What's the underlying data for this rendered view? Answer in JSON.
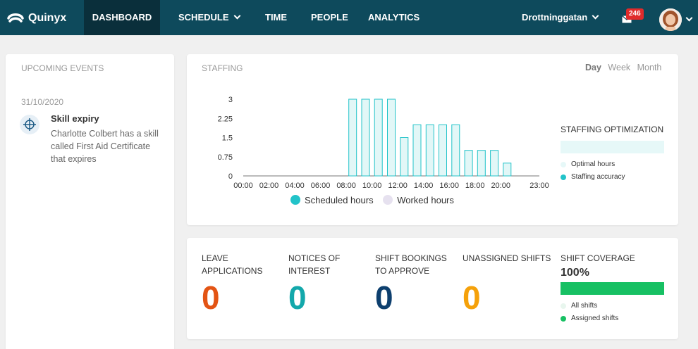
{
  "nav": {
    "logo": "Quinyx",
    "items": [
      "DASHBOARD",
      "SCHEDULE",
      "TIME",
      "PEOPLE",
      "ANALYTICS"
    ],
    "location": "Drottninggatan",
    "notifications": "246"
  },
  "events": {
    "title": "UPCOMING EVENTS",
    "date": "31/10/2020",
    "item_title": "Skill expiry",
    "item_desc": "Charlotte Colbert has a skill called First Aid Certificate that expires"
  },
  "staffing": {
    "title": "STAFFING",
    "periods": [
      "Day",
      "Week",
      "Month"
    ],
    "legend": [
      "Scheduled hours",
      "Worked hours"
    ],
    "optimization_title": "STAFFING OPTIMIZATION",
    "optimization_legend": [
      "Optimal hours",
      "Staffing accuracy"
    ]
  },
  "chart_data": {
    "type": "bar",
    "categories": [
      "08:00",
      "09:00",
      "10:00",
      "11:00",
      "12:00",
      "13:00",
      "14:00",
      "15:00",
      "16:00",
      "17:00",
      "18:00",
      "19:00",
      "20:00"
    ],
    "series": [
      {
        "name": "Scheduled hours",
        "values": [
          3,
          3,
          3,
          3,
          1.5,
          2,
          2,
          2,
          2,
          1,
          1,
          1,
          0.5
        ]
      },
      {
        "name": "Worked hours",
        "values": [
          0,
          0,
          0,
          0,
          0,
          0,
          0,
          0,
          0,
          0,
          0,
          0,
          0
        ]
      }
    ],
    "x_ticks": [
      "00:00",
      "02:00",
      "04:00",
      "06:00",
      "08:00",
      "10:00",
      "12:00",
      "14:00",
      "16:00",
      "18:00",
      "20:00",
      "23:00"
    ],
    "y_ticks": [
      "0",
      "0.75",
      "1.5",
      "2.25",
      "3"
    ],
    "ylim": [
      0,
      3
    ],
    "colors": {
      "scheduled": "#e2f7f7",
      "scheduled_border": "#22c3c9",
      "worked": "#e6e1ef"
    }
  },
  "stats": {
    "leave_applications": {
      "label": "LEAVE APPLICATIONS",
      "value": "0",
      "color": "#e35414"
    },
    "notices_of_interest": {
      "label": "NOTICES OF INTEREST",
      "value": "0",
      "color": "#13a8ab"
    },
    "shift_bookings": {
      "label": "SHIFT BOOKINGS TO APPROVE",
      "value": "0",
      "color": "#0d3f6e"
    },
    "unassigned_shifts": {
      "label": "UNASSIGNED SHIFTS",
      "value": "0",
      "color": "#f5a10a"
    },
    "coverage": {
      "label": "SHIFT COVERAGE",
      "value": "100%",
      "fraction": 1.0,
      "legend": [
        "All shifts",
        "Assigned shifts"
      ]
    }
  }
}
